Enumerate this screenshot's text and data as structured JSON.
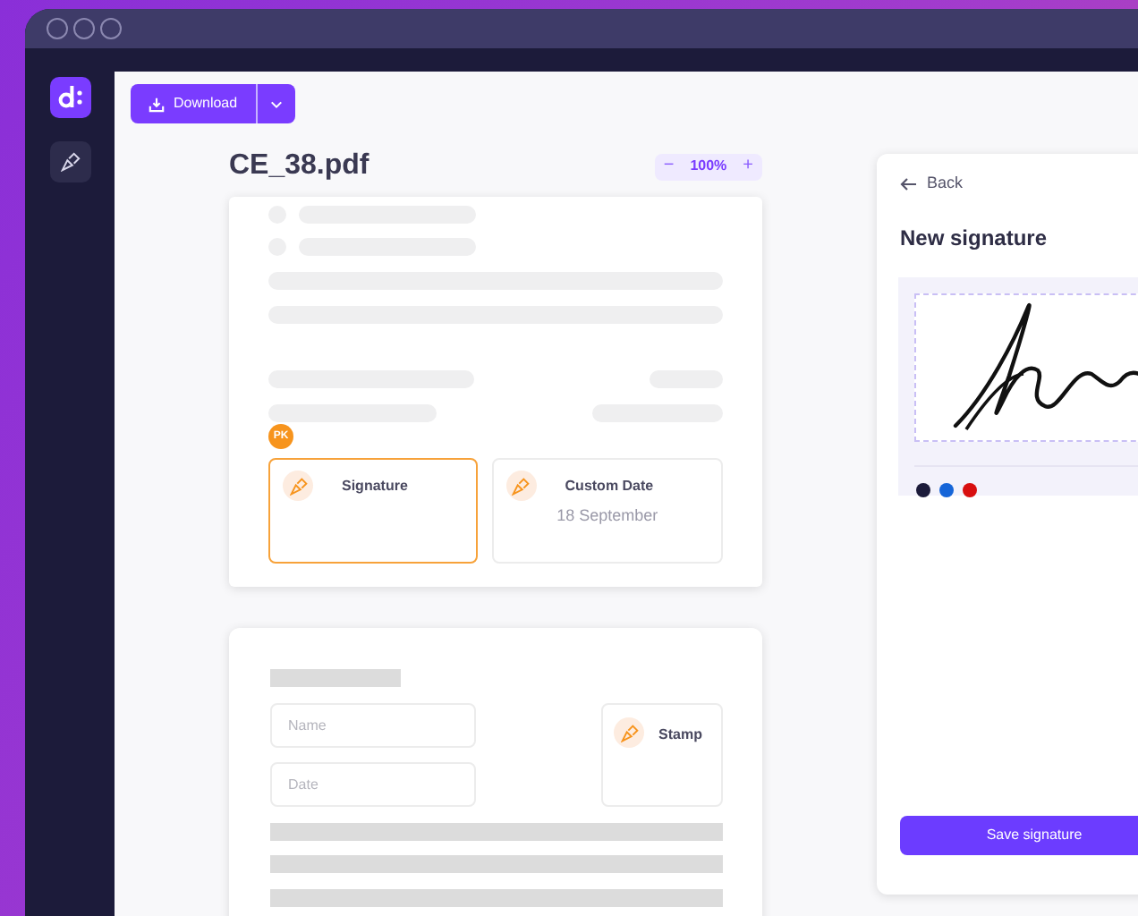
{
  "toolbar": {
    "download_button": "Download"
  },
  "document": {
    "title": "CE_38.pdf",
    "zoom_out": "−",
    "zoom": "100%",
    "zoom_in": "+"
  },
  "page_1": {
    "assignee": "PK",
    "fields": [
      {
        "label": "Signature",
        "selected": true
      },
      {
        "label": "Custom Date",
        "value": "18 September",
        "selected": false
      }
    ]
  },
  "page_2": {
    "inputs": [
      {
        "placeholder": "Name"
      },
      {
        "placeholder": "Date"
      }
    ],
    "stamp": {
      "label": "Stamp"
    }
  },
  "signature_panel": {
    "back": "Back",
    "title": "New signature",
    "colors": [
      {
        "color": "#1c1b3a"
      },
      {
        "color": "#1565d8"
      },
      {
        "color": "#d80f0f"
      }
    ],
    "save_button": "Save signature"
  }
}
